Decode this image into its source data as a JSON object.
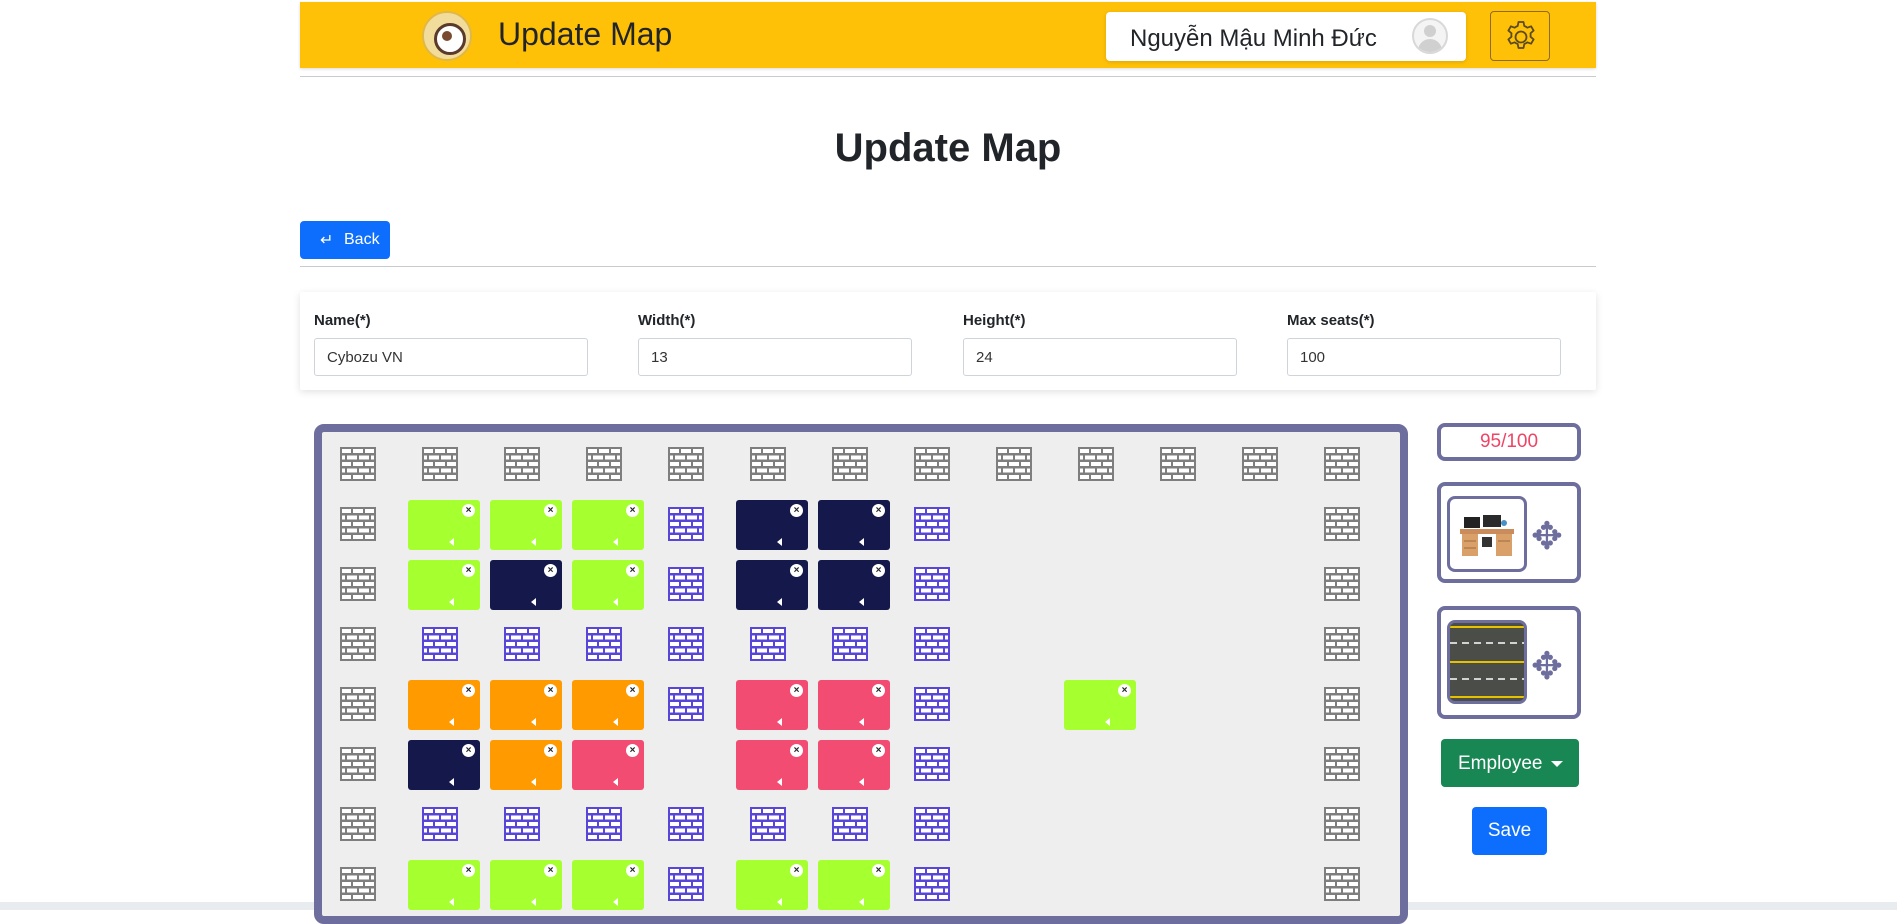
{
  "header": {
    "app_title": "Update Map",
    "user_name": "Nguyễn Mậu Minh Đức"
  },
  "page": {
    "title": "Update Map",
    "back_label": "Back"
  },
  "form": {
    "fields": [
      {
        "label": "Name(*)",
        "value": "Cybozu VN"
      },
      {
        "label": "Width(*)",
        "value": "13"
      },
      {
        "label": "Height(*)",
        "value": "24"
      },
      {
        "label": "Max seats(*)",
        "value": "100"
      }
    ]
  },
  "sidebar": {
    "seat_counter": "95/100",
    "palette_items": [
      {
        "name": "desk",
        "icon": "desk-icon"
      },
      {
        "name": "road",
        "icon": "road-icon"
      }
    ],
    "employee_label": "Employee",
    "save_label": "Save"
  },
  "colors": {
    "header": "#ffc107",
    "frame": "#6e6e9e",
    "green": "#a6ff2e",
    "navy": "#15184a",
    "orange": "#ff9a00",
    "pink": "#f24c72",
    "wall_gray": "#7e7e7e",
    "wall_blue": "#5746d8"
  },
  "map": {
    "legend": {
      "W": "outer-wall",
      "b": "inner-wall",
      "g": "seat-green",
      "n": "seat-navy",
      "o": "seat-orange",
      "p": "seat-pink",
      ".": "empty"
    },
    "rows": [
      "WWWWWWWWWWWWW",
      "Wgggbnnb....W",
      "Wgngbnnb....W",
      "Wbbbbbbb....W",
      "Wooobppb.g..W",
      "Wnop.ppb....W",
      "Wbbbbbbb....W",
      "Wgggbggb....W"
    ]
  }
}
